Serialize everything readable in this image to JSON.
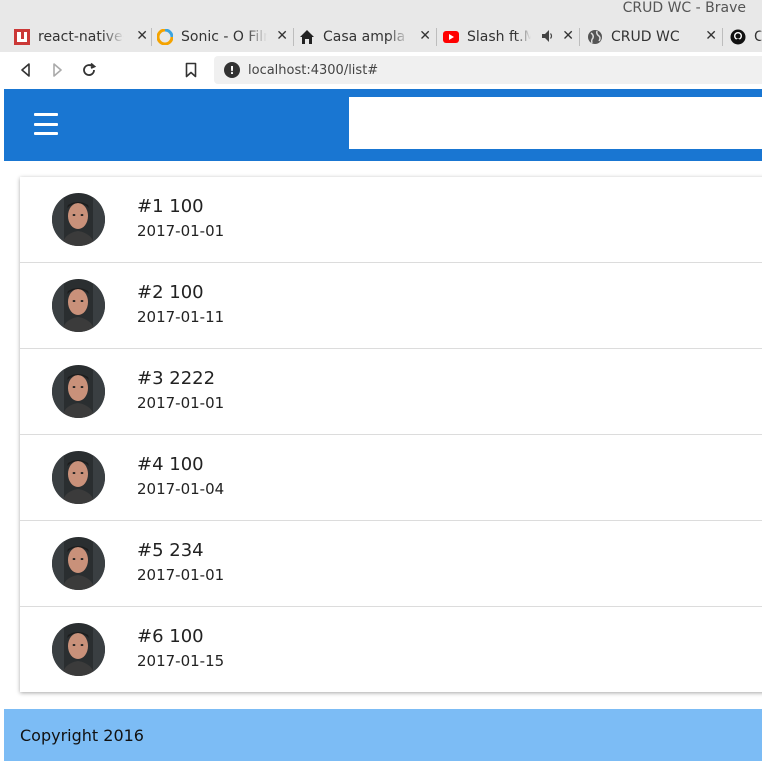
{
  "window": {
    "title": "CRUD WC - Brave"
  },
  "tabs": [
    {
      "label": "react-native-",
      "icon": "npm-icon",
      "close": "✕"
    },
    {
      "label": "Sonic - O Film",
      "icon": "sonic-icon",
      "close": "✕"
    },
    {
      "label": "Casa ampla c",
      "icon": "home-icon",
      "close": "✕"
    },
    {
      "label": "Slash ft.M",
      "icon": "youtube-icon",
      "close": "✕"
    },
    {
      "label": "CRUD WC",
      "icon": "globe-icon",
      "close": "✕"
    },
    {
      "label": "C",
      "icon": "github-icon",
      "close": ""
    }
  ],
  "nav": {
    "url": "localhost:4300/list#"
  },
  "items": [
    {
      "title": "#1 100",
      "date": "2017-01-01"
    },
    {
      "title": "#2 100",
      "date": "2017-01-11"
    },
    {
      "title": "#3 2222",
      "date": "2017-01-01"
    },
    {
      "title": "#4 100",
      "date": "2017-01-04"
    },
    {
      "title": "#5 234",
      "date": "2017-01-01"
    },
    {
      "title": "#6 100",
      "date": "2017-01-15"
    }
  ],
  "footer": {
    "text": "Copyright 2016"
  },
  "colors": {
    "header": "#1976d2",
    "footer": "#7cbcf5",
    "tab_strip": "#e8e8e8"
  }
}
